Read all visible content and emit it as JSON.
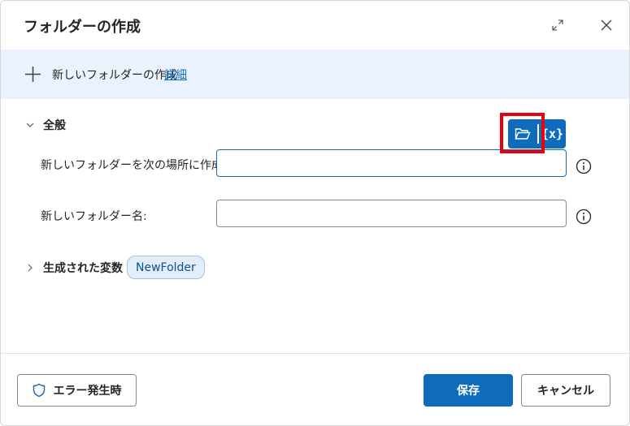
{
  "dialog": {
    "title": "フォルダーの作成"
  },
  "banner": {
    "text": "新しいフォルダーの作成",
    "link": "詳細"
  },
  "sections": {
    "general": "全般",
    "variables": "生成された変数"
  },
  "fields": {
    "location_label": "新しいフォルダーを次の場所に作成:",
    "location_value": "",
    "name_label": "新しいフォルダー名:",
    "name_value": ""
  },
  "picker": {
    "var_label": "{x}"
  },
  "variables": {
    "output_var": "NewFolder"
  },
  "footer": {
    "error_button": "エラー発生時",
    "save_button": "保存",
    "cancel_button": "キャンセル"
  },
  "icons": {
    "expand": "expand-icon",
    "close": "close-icon",
    "plus": "plus-icon",
    "chevron_down": "chevron-down-icon",
    "chevron_right": "chevron-right-icon",
    "info": "info-icon",
    "folder": "folder-open-icon",
    "shield": "shield-icon"
  },
  "colors": {
    "accent": "#0f6cbd",
    "banner_bg": "#eaf2fd",
    "highlight": "#e8000b"
  }
}
